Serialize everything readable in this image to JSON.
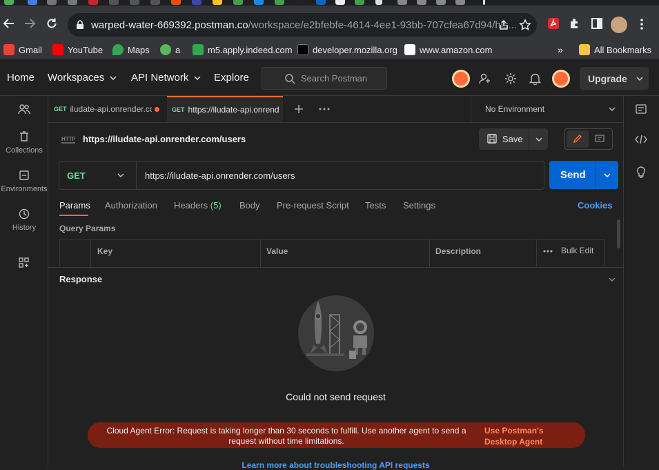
{
  "browser": {
    "url_host": "warped-water-669392.postman.co",
    "url_path": "/workspace/e2bfebfe-4614-4ee1-93bb-707cfea67d94/his...",
    "bookmarks": [
      {
        "label": "Gmail",
        "color": "#ea4335"
      },
      {
        "label": "YouTube",
        "color": "#ff0000"
      },
      {
        "label": "Maps",
        "color": "#34a853"
      },
      {
        "label": "a",
        "color": "#5cb85c"
      },
      {
        "label": "m5.apply.indeed.com",
        "color": "#2164f3"
      },
      {
        "label": "developer.mozilla.org",
        "color": "#000000"
      },
      {
        "label": "www.amazon.com",
        "color": "#ffffff"
      }
    ],
    "all_bookmarks": "All Bookmarks"
  },
  "header": {
    "home": "Home",
    "workspaces": "Workspaces",
    "api_network": "API Network",
    "explore": "Explore",
    "search_placeholder": "Search Postman",
    "upgrade": "Upgrade"
  },
  "sidebar": {
    "items": [
      {
        "label": ""
      },
      {
        "label": "Collections"
      },
      {
        "label": "Environments"
      },
      {
        "label": "History"
      }
    ]
  },
  "tabs": [
    {
      "method": "GET",
      "label": "iludate-api.onrender.cc"
    },
    {
      "method": "GET",
      "label": "https://iludate-api.onrend"
    }
  ],
  "environment": "No Environment",
  "request": {
    "title": "https://iludate-api.onrender.com/users",
    "save_label": "Save",
    "method": "GET",
    "url": "https://iludate-api.onrender.com/users",
    "send_label": "Send",
    "tabs": [
      {
        "label": "Params"
      },
      {
        "label": "Authorization"
      },
      {
        "label": "Headers"
      },
      {
        "label": "Body"
      },
      {
        "label": "Pre-request Script"
      },
      {
        "label": "Tests"
      },
      {
        "label": "Settings"
      }
    ],
    "headers_count": "(5)",
    "cookies": "Cookies",
    "query_params_title": "Query Params",
    "columns": {
      "key": "Key",
      "value": "Value",
      "description": "Description",
      "bulk_edit": "Bulk Edit"
    }
  },
  "response": {
    "title": "Response",
    "message": "Could not send request",
    "error_text": "Cloud Agent Error: Request is taking longer than 30 seconds to fulfill. Use another agent to send a request without time limitations.",
    "error_link": "Use Postman's Desktop Agent",
    "learn_more": "Learn more about troubleshooting API requests"
  },
  "colors": {
    "accent": "#ff6c37",
    "send": "#0265d2",
    "error_bg": "#7a1f12",
    "link": "#4b9fff"
  }
}
